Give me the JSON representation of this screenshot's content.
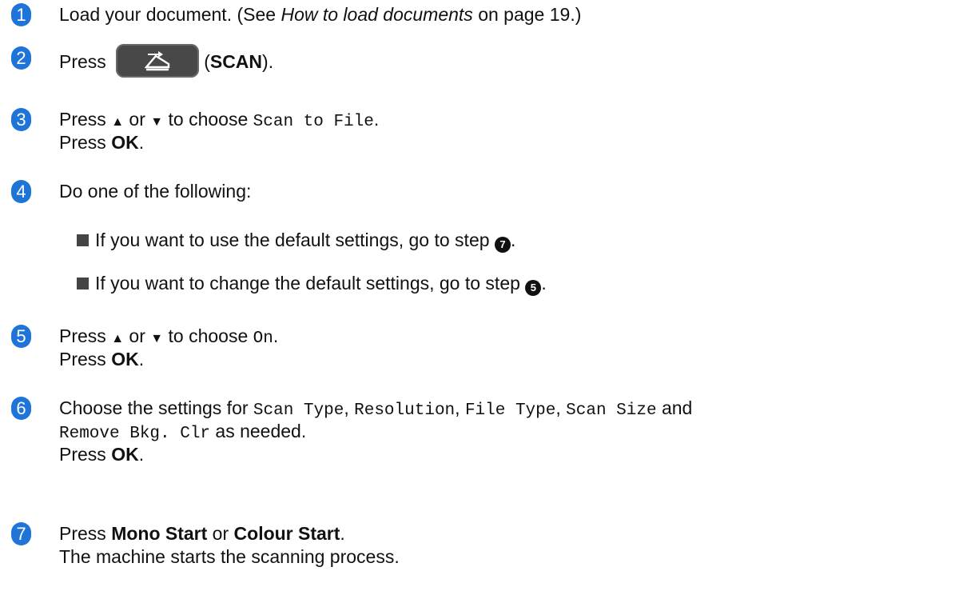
{
  "steps": [
    {
      "num": "1",
      "lines": [
        {
          "pre": "Load your document. (See ",
          "italic": "How to load documents",
          "post": " on page 19.)"
        }
      ]
    },
    {
      "num": "2",
      "pre": "Press",
      "key_icon": "scan-icon",
      "paren_open": "(",
      "bold": "SCAN",
      "paren_close": ")."
    },
    {
      "num": "3",
      "line1": {
        "pre": "Press ",
        "up": "▲",
        "mid": " or ",
        "down": "▼",
        "post": " to choose ",
        "mono": "Scan to File",
        "end": "."
      },
      "line2": {
        "pre": "Press ",
        "bold": "OK",
        "end": "."
      }
    },
    {
      "num": "4",
      "text": "Do one of the following:",
      "bullets": [
        {
          "text": "If you want to use the default settings, go to step ",
          "ref": "7",
          "end": "."
        },
        {
          "text": "If you want to change the default settings, go to step ",
          "ref": "5",
          "end": "."
        }
      ]
    },
    {
      "num": "5",
      "line1": {
        "pre": "Press ",
        "up": "▲",
        "mid": " or ",
        "down": "▼",
        "post": " to choose ",
        "mono": "On",
        "end": "."
      },
      "line2": {
        "pre": "Press ",
        "bold": "OK",
        "end": "."
      }
    },
    {
      "num": "6",
      "line1": {
        "pre": "Choose the settings for ",
        "m1": "Scan Type",
        "c1": ", ",
        "m2": "Resolution",
        "c2": ", ",
        "m3": "File Type",
        "c3": ", ",
        "m4": "Scan Size",
        "and": " and"
      },
      "line2": {
        "mono": "Remove Bkg. Clr",
        "post": " as needed."
      },
      "line3": {
        "pre": "Press ",
        "bold": "OK",
        "end": "."
      }
    },
    {
      "num": "7",
      "line1": {
        "pre": "Press ",
        "b1": "Mono Start",
        "mid": " or ",
        "b2": "Colour Start",
        "end": "."
      },
      "line2": "The machine starts the scanning process."
    }
  ],
  "colors": {
    "step_badge": "#1f74d8",
    "key_bg": "#484848",
    "bullet": "#444444"
  }
}
